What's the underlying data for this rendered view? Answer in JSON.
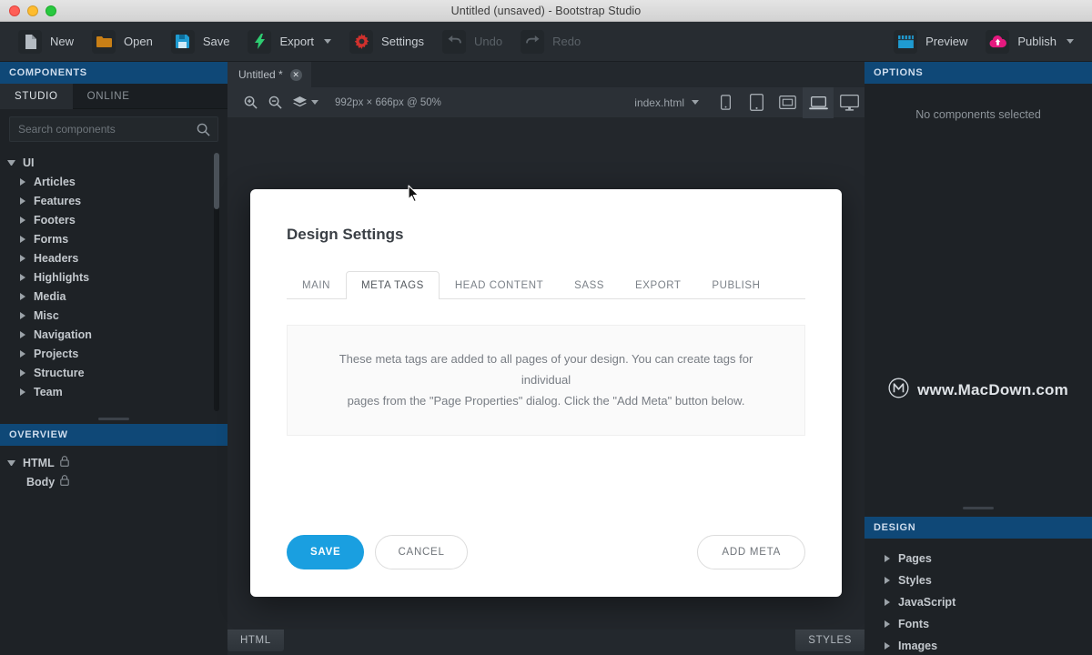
{
  "window": {
    "title": "Untitled (unsaved) - Bootstrap Studio"
  },
  "toolbar": {
    "items": [
      {
        "label": "New",
        "icon": "file-icon",
        "color": "#b4bbc2"
      },
      {
        "label": "Open",
        "icon": "folder-icon",
        "color": "#c87f16"
      },
      {
        "label": "Save",
        "icon": "floppy-disk-icon",
        "color": "#1f9bd1"
      },
      {
        "label": "Export",
        "icon": "lightning-bolt-icon",
        "color": "#2ecc71",
        "caret": true
      },
      {
        "label": "Settings",
        "icon": "gear-icon",
        "color": "#d0312d"
      },
      {
        "label": "Undo",
        "icon": "undo-arrow-icon",
        "color": "#5a6167",
        "disabled": true
      },
      {
        "label": "Redo",
        "icon": "redo-arrow-icon",
        "color": "#5a6167",
        "disabled": true
      }
    ],
    "right_items": [
      {
        "label": "Preview",
        "icon": "clapperboard-icon",
        "color": "#1f9bd1"
      },
      {
        "label": "Publish",
        "icon": "cloud-upload-icon",
        "color": "#e5197f",
        "caret": true
      }
    ]
  },
  "left_panel": {
    "header": "COMPONENTS",
    "tabs": [
      {
        "label": "STUDIO",
        "active": true
      },
      {
        "label": "ONLINE",
        "active": false
      }
    ],
    "search": {
      "placeholder": "Search components",
      "value": "",
      "icon": "search-icon"
    },
    "tree": [
      {
        "label": "UI",
        "level": 0,
        "expanded": true
      },
      {
        "label": "Articles",
        "level": 1,
        "expanded": false
      },
      {
        "label": "Features",
        "level": 1,
        "expanded": false
      },
      {
        "label": "Footers",
        "level": 1,
        "expanded": false
      },
      {
        "label": "Forms",
        "level": 1,
        "expanded": false
      },
      {
        "label": "Headers",
        "level": 1,
        "expanded": false
      },
      {
        "label": "Highlights",
        "level": 1,
        "expanded": false
      },
      {
        "label": "Media",
        "level": 1,
        "expanded": false
      },
      {
        "label": "Misc",
        "level": 1,
        "expanded": false
      },
      {
        "label": "Navigation",
        "level": 1,
        "expanded": false
      },
      {
        "label": "Projects",
        "level": 1,
        "expanded": false
      },
      {
        "label": "Structure",
        "level": 1,
        "expanded": false
      },
      {
        "label": "Team",
        "level": 1,
        "expanded": false
      }
    ],
    "overview_header": "OVERVIEW",
    "overview": [
      {
        "label": "HTML",
        "level": 0,
        "expanded": true,
        "locked": true
      },
      {
        "label": "Body",
        "level": 1,
        "expanded": false,
        "locked": true
      }
    ]
  },
  "right_panel": {
    "options_header": "OPTIONS",
    "options_empty": "No components selected",
    "watermark": {
      "text": "www.MacDown.com",
      "icon": "macdown-logo-icon"
    },
    "design_header": "DESIGN",
    "design_items": [
      {
        "label": "Pages"
      },
      {
        "label": "Styles"
      },
      {
        "label": "JavaScript"
      },
      {
        "label": "Fonts"
      },
      {
        "label": "Images"
      }
    ]
  },
  "canvas": {
    "doc_tab": {
      "label": "Untitled *",
      "close_icon": "close-icon"
    },
    "zoom_in_icon": "zoom-in-icon",
    "zoom_out_icon": "zoom-out-icon",
    "layers_icon": "layers-icon",
    "size_label": "992px × 666px @ 50%",
    "file_select": {
      "label": "index.html",
      "icon": "chevron-down-icon"
    },
    "devices": [
      {
        "name": "phone",
        "icon": "phone-icon",
        "active": false
      },
      {
        "name": "tablet",
        "icon": "tablet-icon",
        "active": false
      },
      {
        "name": "small-screen",
        "icon": "small-screen-icon",
        "active": false
      },
      {
        "name": "laptop",
        "icon": "laptop-icon",
        "active": true
      },
      {
        "name": "desktop",
        "icon": "desktop-icon",
        "active": false
      }
    ]
  },
  "dialog": {
    "title": "Design Settings",
    "tabs": [
      {
        "label": "MAIN",
        "active": false
      },
      {
        "label": "META TAGS",
        "active": true
      },
      {
        "label": "HEAD CONTENT",
        "active": false
      },
      {
        "label": "SASS",
        "active": false
      },
      {
        "label": "EXPORT",
        "active": false
      },
      {
        "label": "PUBLISH",
        "active": false
      }
    ],
    "info_line1": "These meta tags are added to all pages of your design. You can create tags for individual",
    "info_line2": "pages from the \"Page Properties\" dialog. Click the \"Add Meta\" button below.",
    "save_label": "SAVE",
    "cancel_label": "CANCEL",
    "add_meta_label": "ADD META"
  },
  "bottom_bar": {
    "html_label": "HTML",
    "styles_label": "STYLES"
  },
  "colors": {
    "accent_blue": "#1a9fe0",
    "panel_header": "#0f4877",
    "toolbar_bg": "#272c31",
    "sidebar_bg": "#1e2226"
  }
}
